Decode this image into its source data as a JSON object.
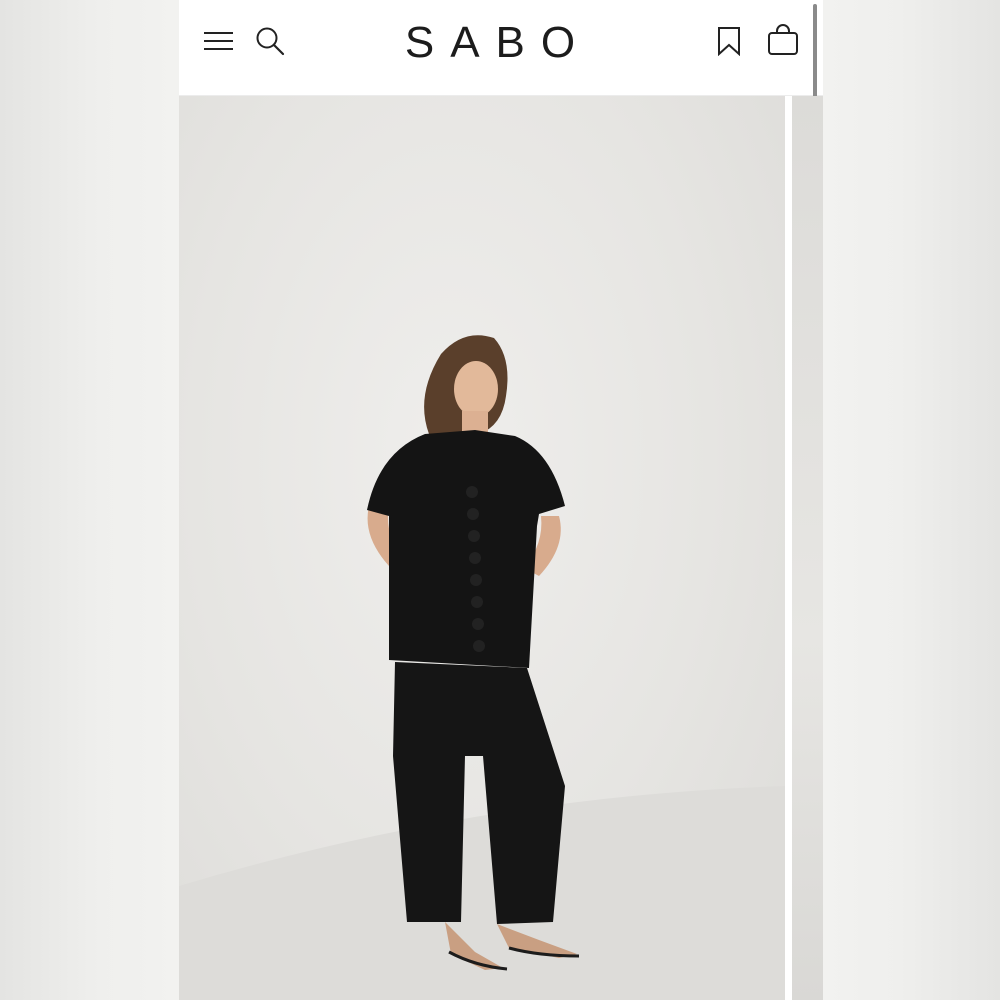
{
  "header": {
    "logo": "SABO",
    "menu_icon": "menu-icon",
    "search_icon": "search-icon",
    "wishlist_icon": "bookmark-icon",
    "bag_icon": "shopping-bag-icon"
  },
  "gallery": {
    "image_description": "product-photo",
    "colors": {
      "background": "#e6e5e2",
      "garment": "#141414"
    }
  }
}
